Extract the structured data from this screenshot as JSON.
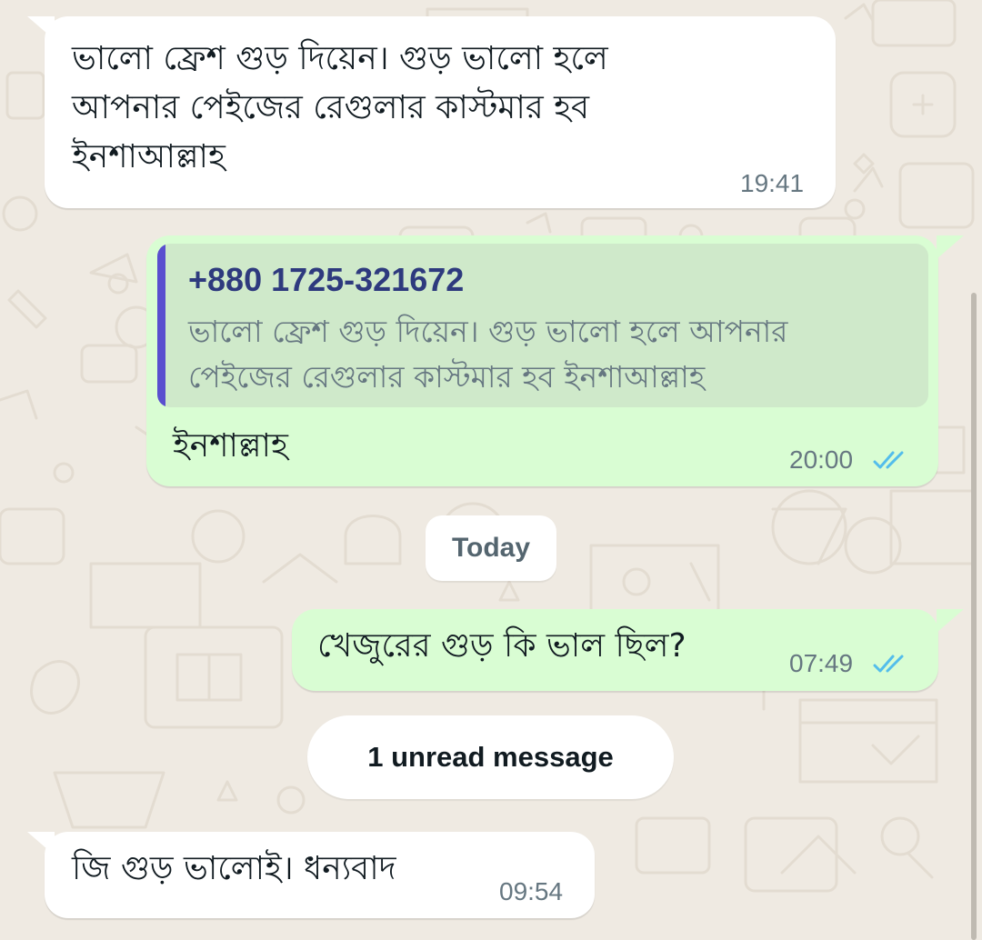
{
  "messages": [
    {
      "direction": "incoming",
      "text_lines": [
        "ভালো ফ্রেশ গুড় দিয়েন। গুড় ভালো হলে",
        "আপনার পেইজের রেগুলার কাস্টমার হব",
        "ইনশাআল্লাহ"
      ],
      "time": "19:41"
    },
    {
      "direction": "outgoing",
      "quoted": {
        "author": "+880 1725-321672",
        "text_lines": [
          "ভালো ফ্রেশ গুড় দিয়েন। গুড় ভালো হলে আপনার",
          "পেইজের রেগুলার কাস্টমার হব ইনশাআল্লাহ"
        ]
      },
      "text": "ইনশাল্লাহ",
      "time": "20:00",
      "status_icon": "double-check-read-icon"
    },
    {
      "direction": "outgoing",
      "text": "খেজুরের গুড় কি ভাল ছিল?",
      "time": "07:49",
      "status_icon": "double-check-read-icon"
    },
    {
      "direction": "incoming",
      "text": "জি গুড় ভালোই। ধন্যবাদ",
      "time": "09:54"
    }
  ],
  "date_divider": "Today",
  "unread_divider": "1 unread message",
  "colors": {
    "wallpaper": "#efeae2",
    "incoming_bubble": "#ffffff",
    "outgoing_bubble": "#d9fdd3",
    "quote_background": "#cfe9ca",
    "quote_accent": "#5a4fcf",
    "read_ticks": "#53bdeb",
    "timestamp": "#667781"
  }
}
